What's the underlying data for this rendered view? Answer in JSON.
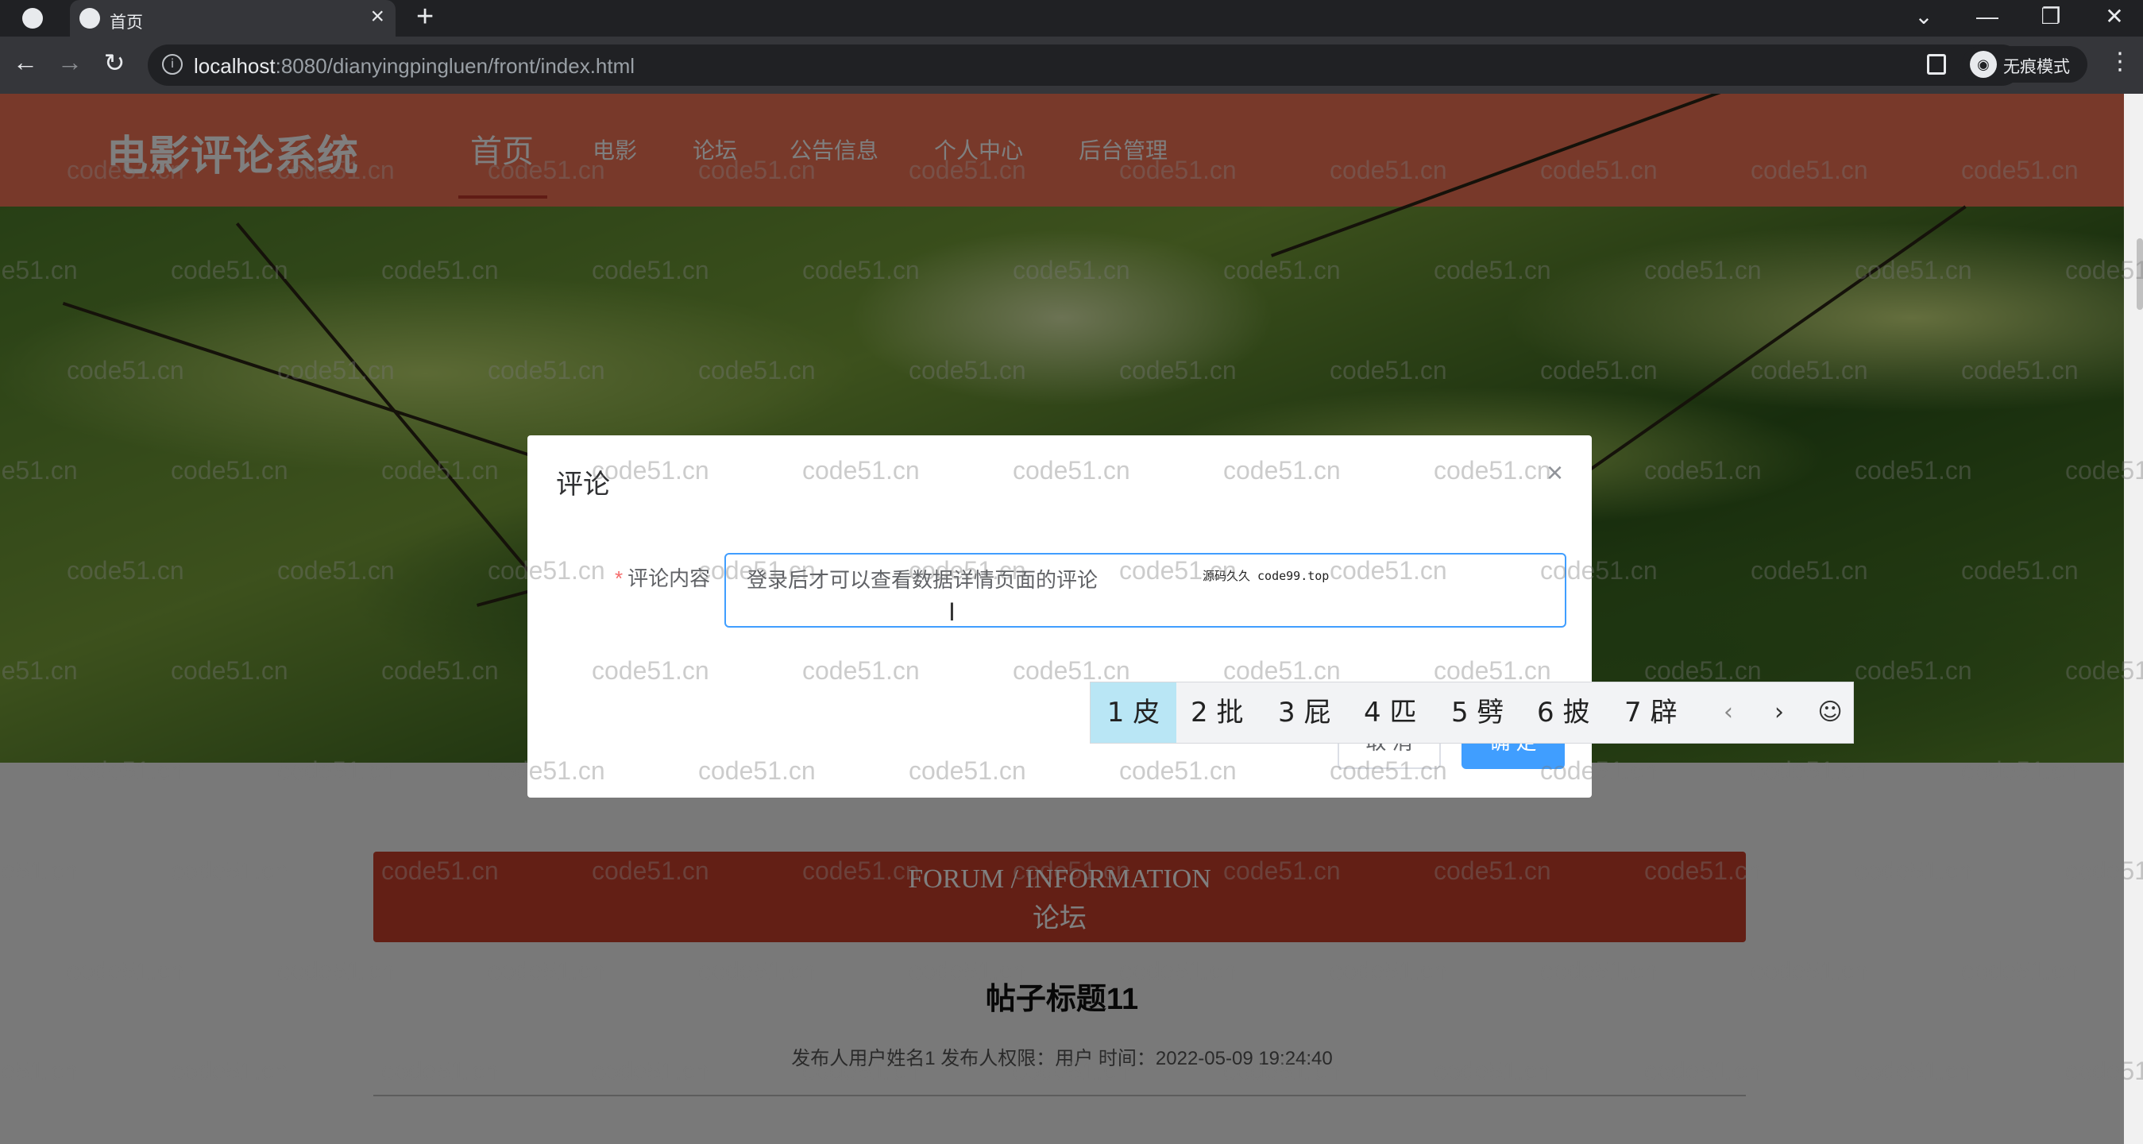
{
  "browser": {
    "tab_title": "首页",
    "url_host": "localhost",
    "url_path": ":8080/dianyingpingluen/front/index.html",
    "profile_label": "无痕模式"
  },
  "site": {
    "title": "电影评论系统",
    "menu": [
      "首页",
      "电影",
      "论坛",
      "公告信息",
      "个人中心",
      "后台管理"
    ],
    "active_menu": "首页"
  },
  "section": {
    "title_en": "FORUM / INFORMATION",
    "title_cn": "论坛"
  },
  "post": {
    "title": "帖子标题11",
    "meta": "发布人用户姓名1   发布人权限：用户   时间：2022-05-09 19:24:40"
  },
  "dialog": {
    "title": "评论",
    "field_label": "评论内容",
    "textarea_placeholder": "登录后才可以查看数据详情页面的评论",
    "ime_composition": "源码久久 code99.top",
    "cancel_label": "取 消",
    "confirm_label": "确 定"
  },
  "ime": {
    "candidates": [
      "1 皮",
      "2 批",
      "3 屁",
      "4 匹",
      "5 劈",
      "6 披",
      "7 辟"
    ],
    "selected_index": 0
  },
  "watermark": "code51.cn",
  "colors": {
    "header": "#f07254",
    "forum_banner": "#c73e2a",
    "primary_button": "#409eff"
  }
}
